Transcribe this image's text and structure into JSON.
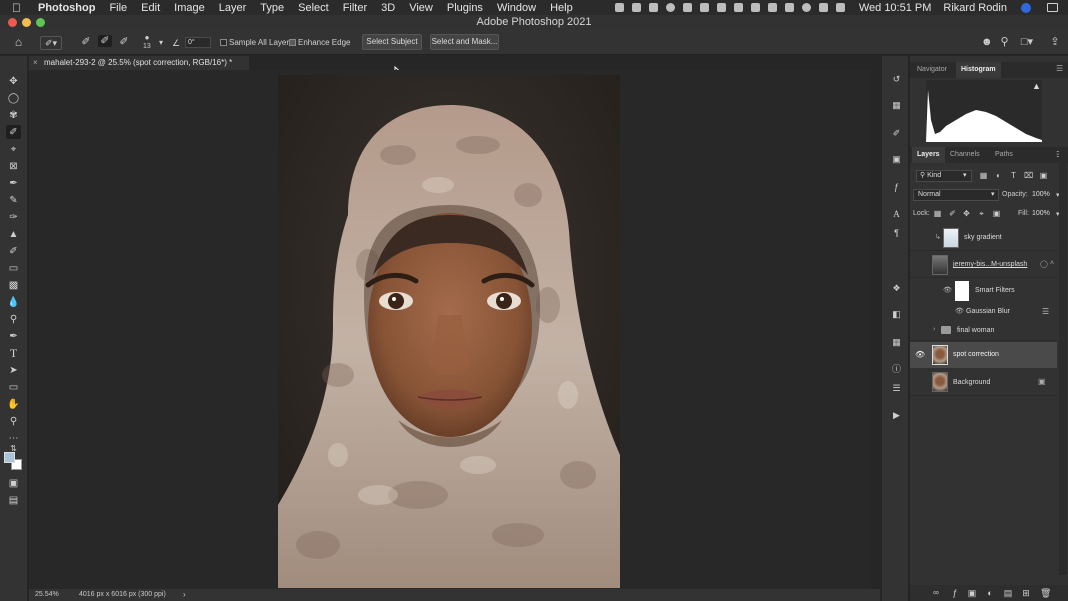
{
  "menubar": {
    "app_name": "Photoshop",
    "items": [
      "File",
      "Edit",
      "Image",
      "Layer",
      "Type",
      "Select",
      "Filter",
      "3D",
      "View",
      "Plugins",
      "Window",
      "Help"
    ],
    "clock": "Wed 10:51 PM",
    "user": "Rikard Rodin"
  },
  "window": {
    "title": "Adobe Photoshop 2021"
  },
  "options": {
    "brush_size": "13",
    "angle": "0°",
    "sample_all_layers": "Sample All Layers",
    "enhance_edge": "Enhance Edge",
    "select_subject": "Select Subject",
    "select_and_mask": "Select and Mask..."
  },
  "document": {
    "tab_title": "mahalet-293-2 @ 25.5% (spot correction, RGB/16*) *",
    "zoom": "25.54%",
    "info": "4016 px x 6016 px (300 ppi)"
  },
  "panels": {
    "top_tabs": [
      "Navigator",
      "Histogram"
    ],
    "layer_tabs": [
      "Layers",
      "Channels",
      "Paths"
    ],
    "kind_filter": "Kind",
    "blend_mode": "Normal",
    "opacity_label": "Opacity:",
    "opacity_value": "100%",
    "lock_label": "Lock:",
    "fill_label": "Fill:",
    "fill_value": "100%"
  },
  "layers": [
    {
      "name": "sky gradient"
    },
    {
      "name": "jeremy-bis...M-unsplash"
    },
    {
      "name": "Smart Filters"
    },
    {
      "name": "Gaussian Blur"
    },
    {
      "name": "final woman"
    },
    {
      "name": "spot correction"
    },
    {
      "name": "Background"
    }
  ],
  "colors": {
    "accent_selected_layer": "#4a4a4a",
    "foreground_swatch": "#a9c3d8",
    "background_swatch": "#ffffff"
  }
}
